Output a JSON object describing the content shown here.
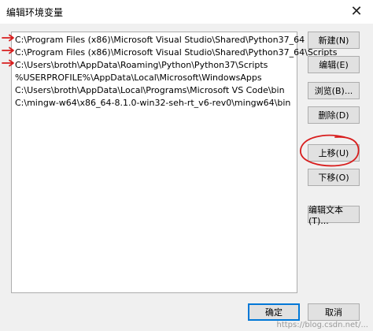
{
  "window": {
    "title": "编辑环境变量",
    "close_glyph": "✕"
  },
  "list": {
    "items": [
      "C:\\Program Files (x86)\\Microsoft Visual Studio\\Shared\\Python37_64",
      "C:\\Program Files (x86)\\Microsoft Visual Studio\\Shared\\Python37_64\\Scripts",
      "C:\\Users\\broth\\AppData\\Roaming\\Python\\Python37\\Scripts",
      "%USERPROFILE%\\AppData\\Local\\Microsoft\\WindowsApps",
      "C:\\Users\\broth\\AppData\\Local\\Programs\\Microsoft VS Code\\bin",
      "C:\\mingw-w64\\x86_64-8.1.0-win32-seh-rt_v6-rev0\\mingw64\\bin"
    ]
  },
  "buttons": {
    "new": "新建(N)",
    "edit": "编辑(E)",
    "browse": "浏览(B)...",
    "delete": "删除(D)",
    "move_up": "上移(U)",
    "move_down": "下移(O)",
    "edit_text": "编辑文本(T)...",
    "ok": "确定",
    "cancel": "取消"
  },
  "annotations": {
    "color": "#d81e1e",
    "arrow_count": 3
  },
  "watermark": "https://blog.csdn.net/..."
}
